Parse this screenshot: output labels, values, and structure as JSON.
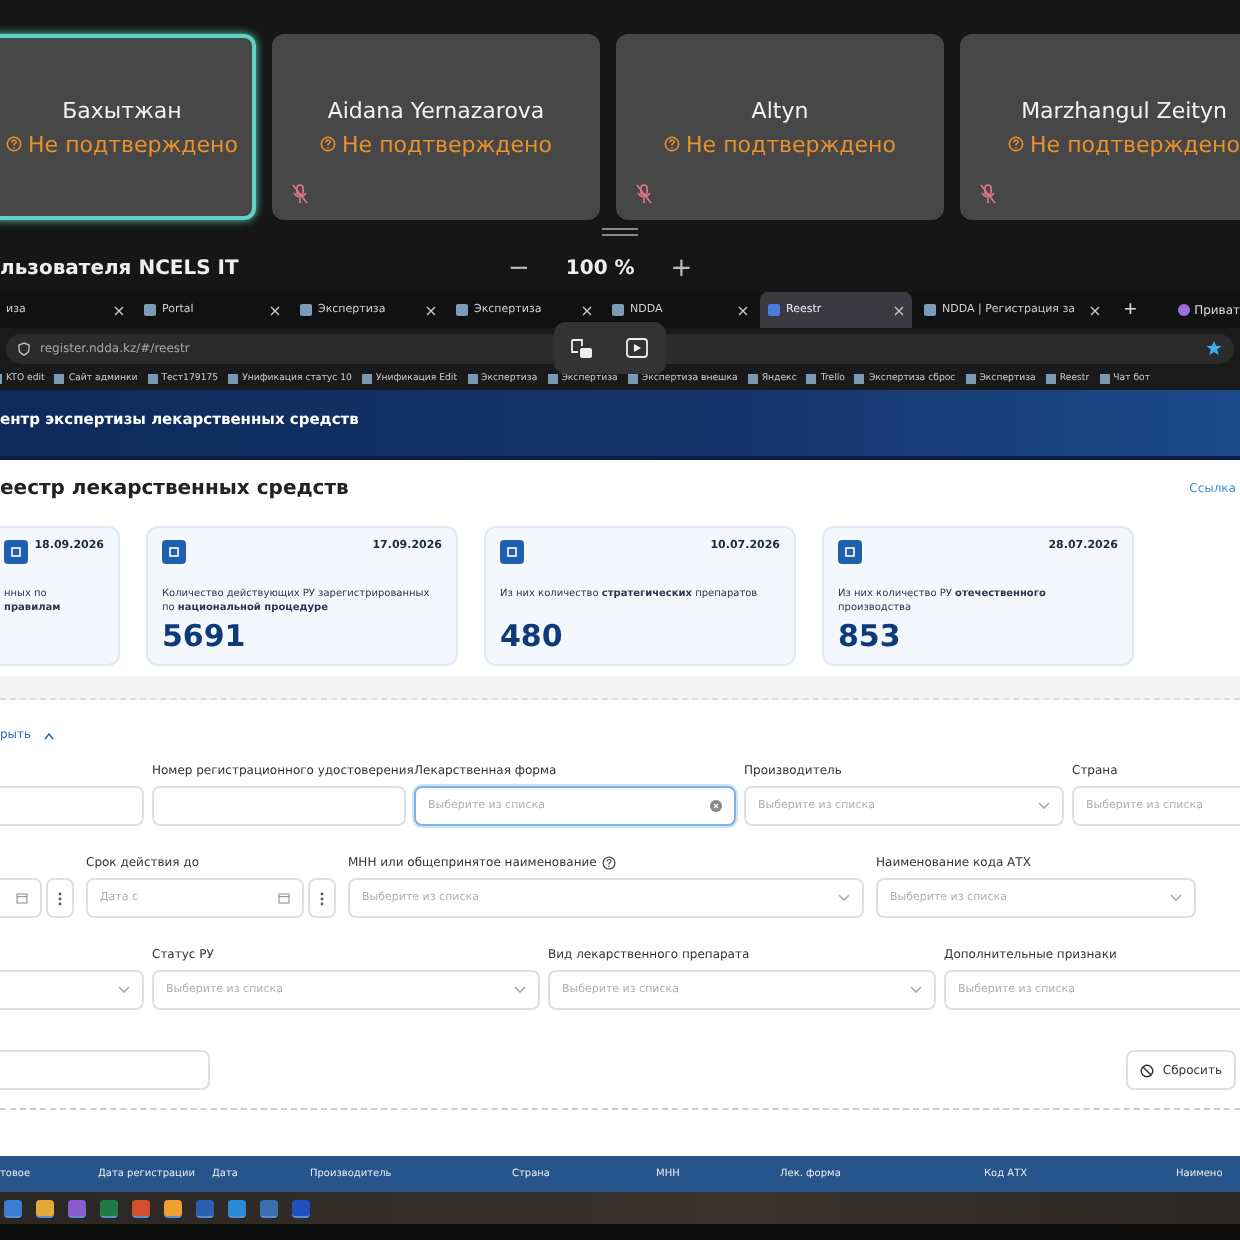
{
  "meeting": {
    "participants": [
      {
        "name": "Бахытжан",
        "status": "Не подтверждено",
        "speaking": true,
        "muted": false
      },
      {
        "name": "Aidana Yernazarova",
        "status": "Не подтверждено",
        "speaking": false,
        "muted": true
      },
      {
        "name": "Altyn",
        "status": "Не подтверждено",
        "speaking": false,
        "muted": true
      },
      {
        "name": "Marzhangul Zeityn",
        "status": "Не подтверждено",
        "speaking": false,
        "muted": true
      }
    ],
    "presenter_label": "льзователя NCELS IT",
    "zoom_out": "−",
    "zoom_value": "100 %",
    "zoom_in": "+"
  },
  "browser": {
    "tabs": [
      {
        "title": "иза",
        "selected": false
      },
      {
        "title": "Portal",
        "selected": false
      },
      {
        "title": "Экспертиза",
        "selected": false
      },
      {
        "title": "Экспертиза",
        "selected": false
      },
      {
        "title": "NDDA",
        "selected": false
      },
      {
        "title": "Reestr",
        "selected": true
      },
      {
        "title": "NDDA | Регистрация за",
        "selected": false
      }
    ],
    "new_tab": "+",
    "profile": "Приват",
    "address": "register.ndda.kz/#/reestr",
    "bookmarks": [
      "KTO edit",
      "Сайт админки",
      "Тест179175",
      "Унификация статус 10",
      "Унификация Edit",
      "Экспертиза",
      "Экспертиза",
      "Экспертиза внешка",
      "Яндекс",
      "Trello",
      "Экспертиза сброс",
      "Экспертиза",
      "Reestr",
      "Чат бот"
    ]
  },
  "site": {
    "header": "ентр экспертизы лекарственных средств",
    "title": "еестр лекарственных средств",
    "link": "Ссылка",
    "stats": [
      {
        "date": "18.09.2026",
        "text": "нных по **правилам**"
      },
      {
        "date": "17.09.2026",
        "text": "Количество действующих РУ зарегистрированных по **национальной процедуре**",
        "value": "5691"
      },
      {
        "date": "10.07.2026",
        "text": "Из них количество **стратегических** препаратов",
        "value": "480"
      },
      {
        "date": "28.07.2026",
        "text": "Из них количество РУ **отечественного** производства",
        "value": "853"
      }
    ],
    "filters": {
      "toggle": "рыть",
      "rows": [
        [
          {
            "kind": "input",
            "focused": false
          },
          {
            "kind": "input",
            "label": "Номер регистрационного удостоверения",
            "focused": false
          },
          {
            "kind": "select",
            "label": "Лекарственная форма",
            "placeholder": "Выберите из списка",
            "focused": true
          },
          {
            "kind": "select",
            "label": "Производитель",
            "placeholder": "Выберите из списка",
            "focused": false
          },
          {
            "kind": "select",
            "label": "Страна",
            "placeholder": "Выберите из списка",
            "focused": false
          }
        ],
        [
          {
            "kind": "date",
            "focused": false
          },
          {
            "kind": "date",
            "label": "Срок действия до",
            "placeholder": "Дата с",
            "focused": false
          },
          {
            "kind": "select",
            "label": "МНН или общепринятое наименование",
            "help": true,
            "placeholder": "Выберите из списка",
            "focused": false
          },
          {
            "kind": "select",
            "label": "Наименование кода АТХ",
            "placeholder": "Выберите из списка",
            "focused": false
          }
        ],
        [
          {
            "kind": "select",
            "focused": false
          },
          {
            "kind": "select",
            "label": "Статус РУ",
            "placeholder": "Выберите из списка",
            "focused": false
          },
          {
            "kind": "select",
            "label": "Вид лекарственного препарата",
            "placeholder": "Выберите из списка",
            "focused": false
          },
          {
            "kind": "select",
            "label": "Дополнительные признаки",
            "placeholder": "Выберите из списка",
            "focused": false
          }
        ]
      ],
      "reset": "Сбросить"
    },
    "table": {
      "columns": [
        "товое",
        "Дата регистрации",
        "Дата",
        "Производитель",
        "Страна",
        "МНН",
        "Лек. форма",
        "Код АТХ",
        "Наимено"
      ]
    }
  }
}
